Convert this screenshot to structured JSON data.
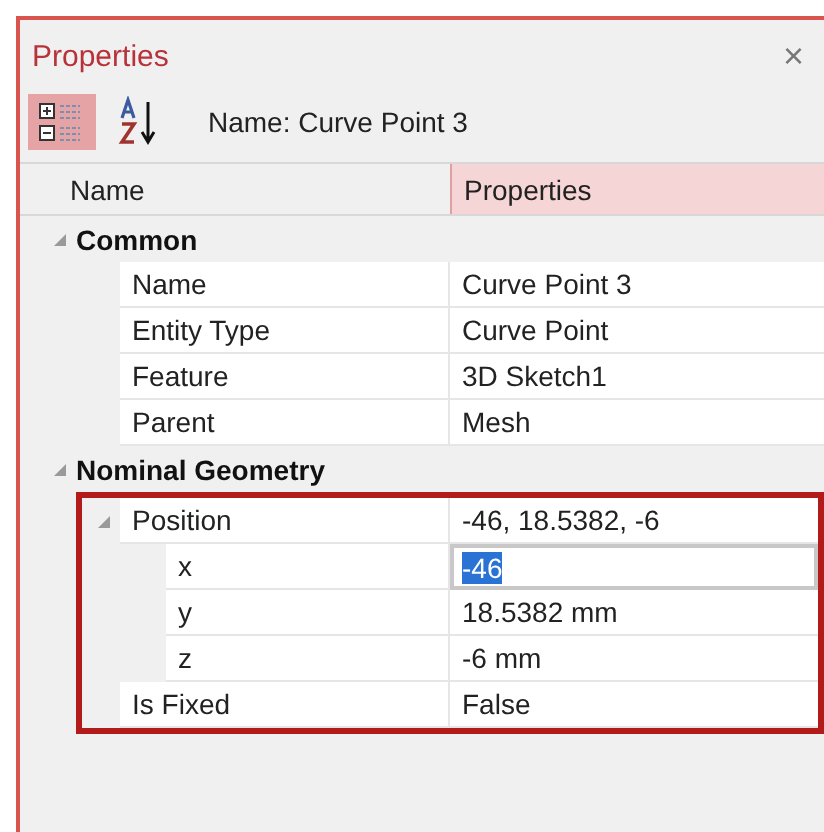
{
  "panel": {
    "title": "Properties",
    "close": "×"
  },
  "toolbar": {
    "buttons": [
      {
        "kind": "categorized",
        "selected": true
      },
      {
        "kind": "alphabetical",
        "selected": false
      }
    ],
    "label": "Name: Curve Point 3"
  },
  "columns": [
    {
      "label": "Name",
      "selected": false
    },
    {
      "label": "Properties",
      "selected": true
    }
  ],
  "categories": [
    {
      "label": "Common",
      "expanded": true,
      "highlighted": false,
      "children": [
        {
          "name": "Name",
          "value": "Curve Point 3"
        },
        {
          "name": "Entity Type",
          "value": "Curve Point"
        },
        {
          "name": "Feature",
          "value": "3D Sketch1"
        },
        {
          "name": "Parent",
          "value": "Mesh"
        }
      ]
    },
    {
      "label": "Nominal Geometry",
      "expanded": true,
      "highlighted": true,
      "children": [
        {
          "name": "Position",
          "value": "-46, 18.5382, -6",
          "expanded": true,
          "children": [
            {
              "name": "x",
              "value": "-46",
              "editing": true
            },
            {
              "name": "y",
              "value": "18.5382 mm",
              "editing": false
            },
            {
              "name": "z",
              "value": "-6 mm",
              "editing": false
            }
          ]
        },
        {
          "name": "Is Fixed",
          "value": "False"
        }
      ]
    }
  ]
}
